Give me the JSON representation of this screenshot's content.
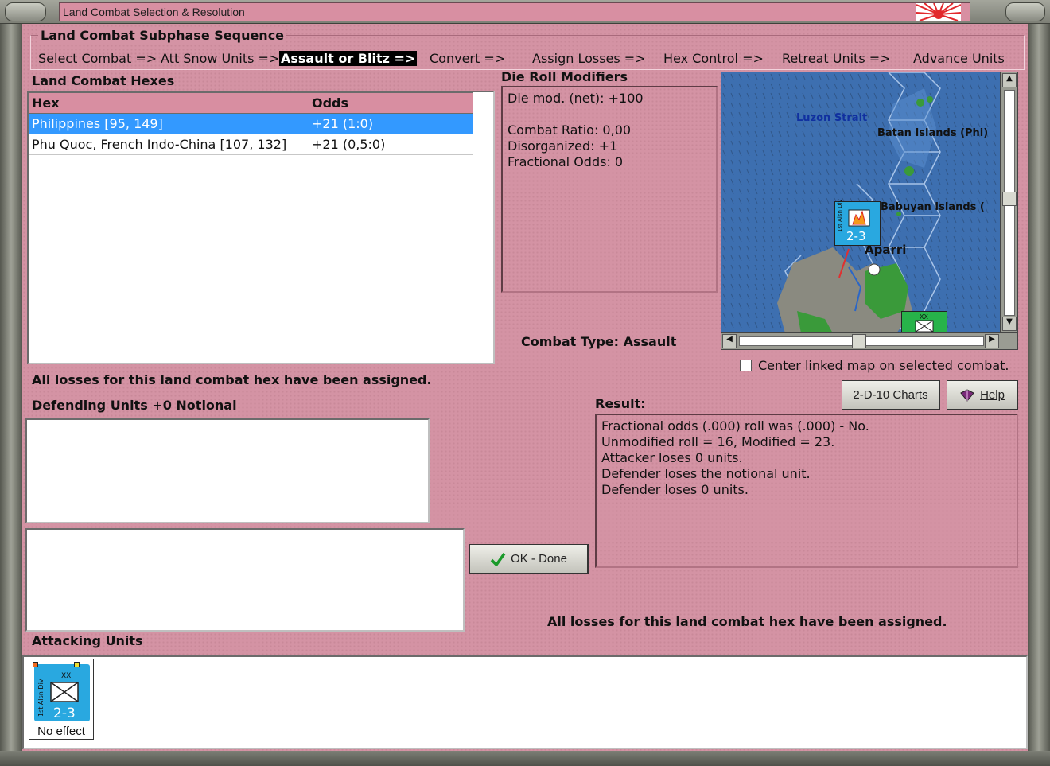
{
  "window": {
    "title": "Land Combat Selection & Resolution"
  },
  "sequence": {
    "title": "Land Combat Subphase Sequence",
    "steps": [
      "Select Combat =>",
      "Att Snow Units =>",
      "Assault or Blitz =>",
      "Convert =>",
      "Assign Losses =>",
      "Hex Control =>",
      "Retreat Units =>",
      "Advance Units"
    ],
    "active_index": 2
  },
  "hexes": {
    "title": "Land Combat Hexes",
    "columns": [
      "Hex",
      "Odds"
    ],
    "rows": [
      {
        "hex": "Philippines [95, 149]",
        "odds": "+21 (1:0)"
      },
      {
        "hex": "Phu Quoc, French Indo-China [107, 132]",
        "odds": "+21 (0,5:0)"
      }
    ],
    "selected_row": 0
  },
  "die_roll": {
    "title": "Die Roll Modifiers",
    "lines": [
      "Die mod. (net): +100",
      "",
      "Combat Ratio: 0,00",
      "Disorganized: +1",
      "Fractional Odds: 0"
    ]
  },
  "map": {
    "labels": {
      "strait": "Luzon Strait",
      "batan": "Batan Islands (Phi)",
      "babuyan": "Babuyan Islands (",
      "aparri": "Aparri"
    },
    "unit_value": "2-3",
    "unit_side_label": "1st Alsn Div",
    "unit2_size": "XX",
    "colors": {
      "sea": "#3d6fb0",
      "land_green": "#3a9a3a",
      "mountain": "#8a8a80",
      "unit_blue": "#29a8e0",
      "unit_green": "#27b34a"
    }
  },
  "center_map": {
    "label": "Center linked map on selected combat.",
    "checked": false
  },
  "combat_type": "Combat Type:  Assault",
  "losses_msg": "All losses for this land combat hex have been assigned.",
  "losses_msg_right": "All losses for this land combat hex have been assigned.",
  "defending": {
    "title": "Defending Units +0 Notional"
  },
  "buttons": {
    "charts": "2-D-10 Charts",
    "help": "Help",
    "ok": "OK - Done"
  },
  "result": {
    "title": "Result:",
    "lines": [
      "Fractional odds (.000) roll was (.000)  - No.",
      "Unmodified roll = 16, Modified = 23.",
      "Attacker loses 0 units.",
      "Defender loses the notional unit.",
      "Defender loses 0 units."
    ]
  },
  "attacking": {
    "title": "Attacking Units",
    "units": [
      {
        "side_label": "1st Alsn Div",
        "size": "XX",
        "strength": "2-3",
        "status": "No effect"
      }
    ]
  }
}
